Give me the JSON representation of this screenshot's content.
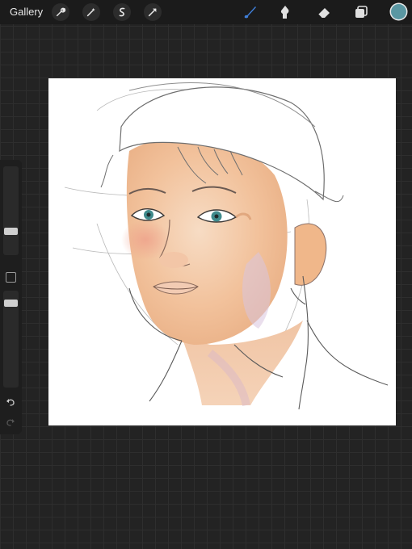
{
  "topbar": {
    "gallery_label": "Gallery",
    "left_tools": [
      "wrench-icon",
      "magic-wand-icon",
      "selection-icon",
      "transform-arrow-icon"
    ],
    "right_tools": [
      "brush-icon",
      "smudge-icon",
      "eraser-icon",
      "layers-icon"
    ],
    "active_tool": "brush-icon",
    "current_color": "#5a97a2",
    "accent_color": "#3f7fd9"
  },
  "sidebar": {
    "brush_size": 0.25,
    "opacity": 0.9,
    "items": [
      "brush-size-slider",
      "modify-button",
      "opacity-slider",
      "undo-icon",
      "redo-icon"
    ]
  },
  "canvas": {
    "content": "sketch-portrait-artwork",
    "background": "#ffffff"
  }
}
